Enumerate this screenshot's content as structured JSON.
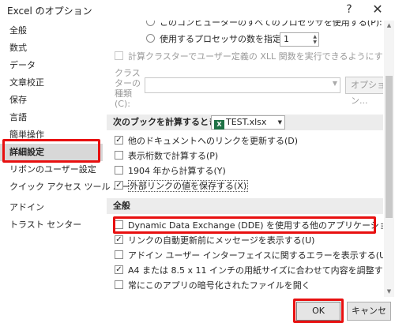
{
  "window": {
    "title": "Excel のオプション",
    "help": "?",
    "close": "✕"
  },
  "sidebar": {
    "items": [
      {
        "label": "全般"
      },
      {
        "label": "数式"
      },
      {
        "label": "データ"
      },
      {
        "label": "文章校正"
      },
      {
        "label": "保存"
      },
      {
        "label": "言語"
      },
      {
        "label": "簡単操作"
      },
      {
        "label": "詳細設定",
        "selected": true
      },
      {
        "label": "リボンのユーザー設定"
      },
      {
        "label": "クイック アクセス ツール バー"
      },
      {
        "label": "アドイン"
      },
      {
        "label": "トラスト センター"
      }
    ]
  },
  "content": {
    "top_cut_text": "このコンピューターのすべてのプロセッサを使用する(P):   8",
    "use_processors": {
      "label": "使用するプロセッサの数を指定する(M):",
      "value": "1"
    },
    "cluster_calc": {
      "label": "計算クラスターでユーザー定義の XLL 関数を実行できるようにする(W)",
      "checked": false
    },
    "cluster_type": {
      "label": "クラスターの種類(C):",
      "value": "",
      "options_button": "オプション..."
    },
    "workbook_section": {
      "label": "次のブックを計算するとき(H):",
      "workbook": "TEST.xlsx"
    },
    "workbook_options": [
      {
        "label": "他のドキュメントへのリンクを更新する(D)",
        "checked": true
      },
      {
        "label": "表示桁数で計算する(P)",
        "checked": false
      },
      {
        "label": "1904 年から計算する(Y)",
        "checked": false
      },
      {
        "label": "外部リンクの値を保存する(X)",
        "checked": true
      }
    ],
    "general_section": {
      "label": "全般"
    },
    "general_options": [
      {
        "label": "Dynamic Data Exchange (DDE) を使用する他のアプリケーションを無視する(O)",
        "checked": false
      },
      {
        "label": "リンクの自動更新前にメッセージを表示する(U)",
        "checked": true
      },
      {
        "label": "アドイン ユーザー インターフェイスに関するエラーを表示する(U)",
        "checked": false
      },
      {
        "label": "A4 または 8.5 x 11 インチの用紙サイズに合わせて内容を調整する(A)",
        "checked": true
      },
      {
        "label": "常にこのアプリの暗号化されたファイルを開く",
        "checked": false
      }
    ]
  },
  "buttons": {
    "ok": "OK",
    "cancel": "キャンセル"
  },
  "colors": {
    "highlight": "#e81010",
    "section_bg": "#ececec",
    "selected_bg": "#d8d8d8",
    "excel_green": "#1e7145"
  }
}
